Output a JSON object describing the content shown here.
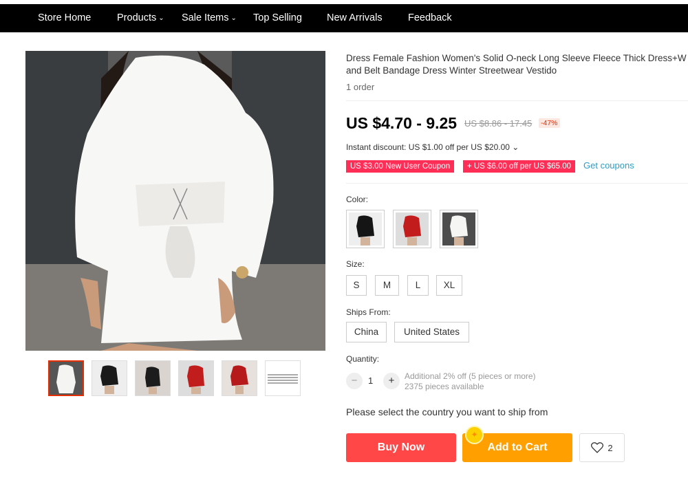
{
  "nav": {
    "items": [
      {
        "label": "Store Home",
        "has_dropdown": false
      },
      {
        "label": "Products",
        "has_dropdown": true
      },
      {
        "label": "Sale Items",
        "has_dropdown": true
      },
      {
        "label": "Top Selling",
        "has_dropdown": false
      },
      {
        "label": "New Arrivals",
        "has_dropdown": false
      },
      {
        "label": "Feedback",
        "has_dropdown": false
      }
    ]
  },
  "product": {
    "title_line1": "Dress Female Fashion Women's Solid O-neck Long Sleeve Fleece Thick Dress+W",
    "title_line2": "and Belt Bandage Dress Winter Streetwear Vestido",
    "orders": "1 order",
    "price": "US $4.70 - 9.25",
    "original_price": "US $8.86 - 17.45",
    "discount": "-47%",
    "instant_discount": "Instant discount: US $1.00 off per US $20.00 ⌄",
    "coupon_new_user": "US $3.00 New User Coupon",
    "coupon_spend": "+ US $6.00 off per US $65.00",
    "get_coupons": "Get coupons"
  },
  "options": {
    "color_label": "Color:",
    "colors": [
      "black",
      "red",
      "white"
    ],
    "size_label": "Size:",
    "sizes": [
      "S",
      "M",
      "L",
      "XL"
    ],
    "ships_from_label": "Ships From:",
    "ships_from": [
      "China",
      "United States"
    ],
    "quantity_label": "Quantity:",
    "quantity": "1",
    "minus": "−",
    "plus": "+",
    "bulk_note": "Additional 2% off (5 pieces or more)",
    "available": "2375 pieces available"
  },
  "ship_message": "Please select the country you want to ship from",
  "actions": {
    "buy_now": "Buy Now",
    "add_to_cart": "Add to Cart",
    "wishlist_count": "2"
  },
  "colors": {
    "nav_bg": "#000000",
    "buy_now": "#ff4747",
    "add_to_cart": "#ffa000",
    "coupon": "#ff2e57",
    "accent_link": "#2e9cc3"
  }
}
